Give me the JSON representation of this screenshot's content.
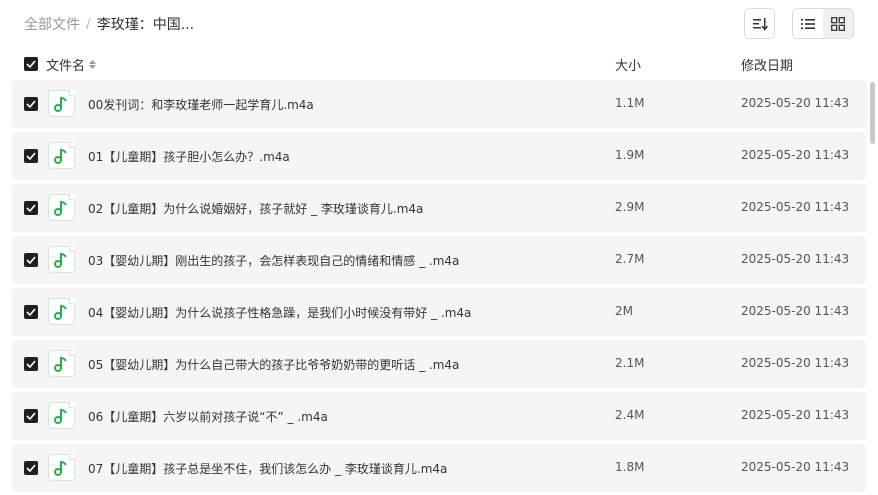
{
  "breadcrumb": {
    "root": "全部文件",
    "separator": "/",
    "current": "李玫瑾：中国..."
  },
  "toolbar": {
    "sort_icon": "sort-lines-icon",
    "list_view_icon": "list-view-icon",
    "grid_view_icon": "grid-view-icon"
  },
  "columns": {
    "name": "文件名",
    "size": "大小",
    "modified": "修改日期"
  },
  "files": [
    {
      "name": "00发刊词：和李玫瑾老师一起学育儿.m4a",
      "size": "1.1M",
      "date": "2025-05-20 11:43"
    },
    {
      "name": "01【儿童期】孩子胆小怎么办？.m4a",
      "size": "1.9M",
      "date": "2025-05-20 11:43"
    },
    {
      "name": "02【儿童期】为什么说婚姻好，孩子就好 _ 李玫瑾谈育儿.m4a",
      "size": "2.9M",
      "date": "2025-05-20 11:43"
    },
    {
      "name": "03【婴幼儿期】刚出生的孩子，会怎样表现自己的情绪和情感 _ .m4a",
      "size": "2.7M",
      "date": "2025-05-20 11:43"
    },
    {
      "name": "04【婴幼儿期】为什么说孩子性格急躁，是我们小时候没有带好 _ .m4a",
      "size": "2M",
      "date": "2025-05-20 11:43"
    },
    {
      "name": "05【婴幼儿期】为什么自己带大的孩子比爷爷奶奶带的更听话 _ .m4a",
      "size": "2.1M",
      "date": "2025-05-20 11:43"
    },
    {
      "name": "06【儿童期】六岁以前对孩子说“不” _ .m4a",
      "size": "2.4M",
      "date": "2025-05-20 11:43"
    },
    {
      "name": "07【儿童期】孩子总是坐不住，我们该怎么办 _ 李玫瑾谈育儿.m4a",
      "size": "1.8M",
      "date": "2025-05-20 11:43"
    }
  ],
  "colors": {
    "accent_green": "#27b04a",
    "checkbox": "#1f1f1f",
    "row_bg": "#f5f5f5"
  }
}
